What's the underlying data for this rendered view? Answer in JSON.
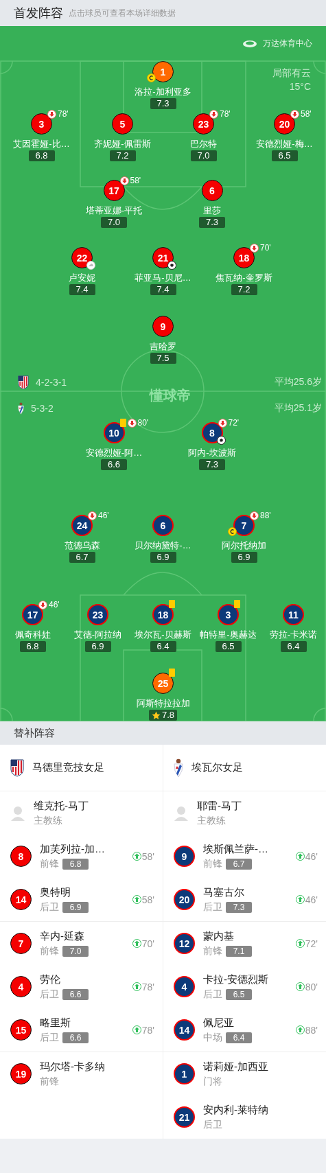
{
  "header": {
    "title": "首发阵容",
    "hint": "点击球员可查看本场详细数据"
  },
  "pitch": {
    "venue": "万达体育中心",
    "weather": "局部有云",
    "temperature": "15°C",
    "watermark": "懂球帝",
    "home": {
      "formation": "4-2-3-1",
      "average_age": "平均25.6岁",
      "lines": [
        {
          "players": [
            {
              "number": "1",
              "name": "洛拉-加利亚多",
              "rating": "7.3",
              "goalkeeper": true,
              "events": [
                {
                  "kind": "captain"
                }
              ]
            }
          ]
        },
        {
          "players": [
            {
              "number": "3",
              "name": "艾因霍娅-比…",
              "rating": "6.8",
              "goalkeeper": false,
              "events": [
                {
                  "kind": "sub_off",
                  "minute": "78'"
                }
              ]
            },
            {
              "number": "5",
              "name": "齐妮娅-佩雷斯",
              "rating": "7.2",
              "goalkeeper": false
            },
            {
              "number": "23",
              "name": "巴尔特",
              "rating": "7.0",
              "goalkeeper": false,
              "events": [
                {
                  "kind": "sub_off",
                  "minute": "78'"
                }
              ]
            },
            {
              "number": "20",
              "name": "安德烈娅-梅…",
              "rating": "6.5",
              "goalkeeper": false,
              "events": [
                {
                  "kind": "sub_off",
                  "minute": "58'"
                }
              ]
            }
          ]
        },
        {
          "players": [
            {
              "number": "17",
              "name": "塔蒂亚娜-平托",
              "rating": "7.0",
              "goalkeeper": false,
              "events": [
                {
                  "kind": "sub_off",
                  "minute": "58'"
                }
              ]
            },
            {
              "number": "6",
              "name": "里莎",
              "rating": "7.3",
              "goalkeeper": false
            }
          ]
        },
        {
          "players": [
            {
              "number": "22",
              "name": "卢安妮",
              "rating": "7.4",
              "goalkeeper": false,
              "events": [
                {
                  "kind": "assist"
                }
              ]
            },
            {
              "number": "21",
              "name": "菲亚马-贝尼…",
              "rating": "7.4",
              "goalkeeper": false,
              "events": [
                {
                  "kind": "goal"
                }
              ]
            },
            {
              "number": "18",
              "name": "焦瓦纳-奎罗斯",
              "rating": "7.2",
              "goalkeeper": false,
              "events": [
                {
                  "kind": "sub_off",
                  "minute": "70'"
                }
              ]
            }
          ]
        },
        {
          "players": [
            {
              "number": "9",
              "name": "吉哈罗",
              "rating": "7.5",
              "goalkeeper": false
            }
          ]
        }
      ]
    },
    "away": {
      "formation": "5-3-2",
      "average_age": "平均25.1岁",
      "lines": [
        {
          "players": [
            {
              "number": "10",
              "name": "安德烈娅-阿…",
              "rating": "6.6",
              "goalkeeper": false,
              "events": [
                {
                  "kind": "yellow"
                },
                {
                  "kind": "sub_off",
                  "minute": "80'"
                }
              ]
            },
            {
              "number": "8",
              "name": "阿内-坎波斯",
              "rating": "7.3",
              "goalkeeper": false,
              "events": [
                {
                  "kind": "sub_off",
                  "minute": "72'"
                },
                {
                  "kind": "goal"
                }
              ]
            }
          ]
        },
        {
          "players": [
            {
              "number": "24",
              "name": "范德乌森",
              "rating": "6.7",
              "goalkeeper": false,
              "events": [
                {
                  "kind": "sub_off",
                  "minute": "46'"
                }
              ]
            },
            {
              "number": "6",
              "name": "贝尔纳黛特-…",
              "rating": "6.9",
              "goalkeeper": false
            },
            {
              "number": "7",
              "name": "阿尔托纳加",
              "rating": "6.9",
              "goalkeeper": false,
              "events": [
                {
                  "kind": "sub_off",
                  "minute": "88'"
                },
                {
                  "kind": "captain"
                }
              ]
            }
          ]
        },
        {
          "players": [
            {
              "number": "17",
              "name": "佩奇科娃",
              "rating": "6.8",
              "goalkeeper": false,
              "events": [
                {
                  "kind": "sub_off",
                  "minute": "46'"
                }
              ]
            },
            {
              "number": "23",
              "name": "艾德-阿拉纳",
              "rating": "6.9",
              "goalkeeper": false
            },
            {
              "number": "18",
              "name": "埃尔瓦-贝赫斯",
              "rating": "6.4",
              "goalkeeper": false,
              "events": [
                {
                  "kind": "yellow"
                }
              ]
            },
            {
              "number": "3",
              "name": "帕特里-奥赫达",
              "rating": "6.5",
              "goalkeeper": false,
              "events": [
                {
                  "kind": "yellow"
                }
              ]
            },
            {
              "number": "11",
              "name": "劳拉-卡米诺",
              "rating": "6.4",
              "goalkeeper": false
            }
          ]
        },
        {
          "players": [
            {
              "number": "25",
              "name": "阿斯特拉拉加",
              "rating": "7.8",
              "goalkeeper": true,
              "events": [
                {
                  "kind": "yellow"
                },
                {
                  "kind": "best"
                }
              ]
            }
          ]
        }
      ]
    }
  },
  "bench": {
    "title": "替补阵容",
    "home": {
      "team": "马德里竞技女足",
      "coach": "维克托-马丁",
      "coach_role": "主教练"
    },
    "away": {
      "team": "埃瓦尔女足",
      "coach": "耶雷-马丁",
      "coach_role": "主教练"
    },
    "groups": [
      [
        {
          "home": {
            "number": "8",
            "name": "加芙列拉-加…",
            "position": "前锋",
            "rating": "6.8",
            "sub_on": "58'"
          },
          "away": {
            "number": "9",
            "name": "埃斯佩兰萨-…",
            "position": "前锋",
            "rating": "6.7",
            "sub_on": "46'"
          }
        },
        {
          "home": {
            "number": "14",
            "name": "奥特明",
            "position": "后卫",
            "rating": "6.9",
            "sub_on": "58'"
          },
          "away": {
            "number": "20",
            "name": "马塞古尔",
            "position": "后卫",
            "rating": "7.3",
            "sub_on": "46'"
          }
        }
      ],
      [
        {
          "home": {
            "number": "7",
            "name": "辛内-延森",
            "position": "前锋",
            "rating": "7.0",
            "sub_on": "70'"
          },
          "away": {
            "number": "12",
            "name": "蒙内基",
            "position": "前锋",
            "rating": "7.1",
            "sub_on": "72'"
          }
        },
        {
          "home": {
            "number": "4",
            "name": "劳伦",
            "position": "后卫",
            "rating": "6.6",
            "sub_on": "78'"
          },
          "away": {
            "number": "4",
            "name": "卡拉-安德烈斯",
            "position": "后卫",
            "rating": "6.5",
            "sub_on": "80'"
          }
        },
        {
          "home": {
            "number": "15",
            "name": "略里斯",
            "position": "后卫",
            "rating": "6.6",
            "sub_on": "78'"
          },
          "away": {
            "number": "14",
            "name": "佩尼亚",
            "position": "中场",
            "rating": "6.4",
            "sub_on": "88'"
          }
        }
      ],
      [
        {
          "home": {
            "number": "19",
            "name": "玛尔塔-卡多纳",
            "position": "前锋"
          },
          "away": {
            "number": "1",
            "name": "诺莉娅-加西亚",
            "position": "门将"
          }
        },
        {
          "away": {
            "number": "21",
            "name": "安内利-莱特纳",
            "position": "后卫"
          }
        }
      ]
    ]
  }
}
